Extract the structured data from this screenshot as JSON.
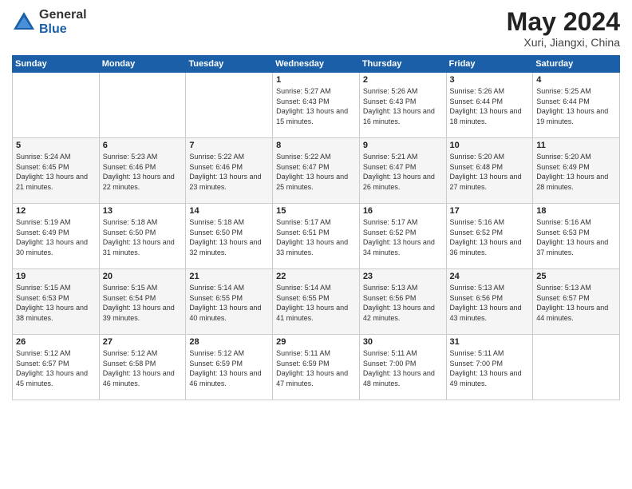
{
  "logo": {
    "general": "General",
    "blue": "Blue"
  },
  "title": "May 2024",
  "subtitle": "Xuri, Jiangxi, China",
  "weekdays": [
    "Sunday",
    "Monday",
    "Tuesday",
    "Wednesday",
    "Thursday",
    "Friday",
    "Saturday"
  ],
  "weeks": [
    [
      {
        "day": "",
        "sunrise": "",
        "sunset": "",
        "daylight": ""
      },
      {
        "day": "",
        "sunrise": "",
        "sunset": "",
        "daylight": ""
      },
      {
        "day": "",
        "sunrise": "",
        "sunset": "",
        "daylight": ""
      },
      {
        "day": "1",
        "sunrise": "Sunrise: 5:27 AM",
        "sunset": "Sunset: 6:43 PM",
        "daylight": "Daylight: 13 hours and 15 minutes."
      },
      {
        "day": "2",
        "sunrise": "Sunrise: 5:26 AM",
        "sunset": "Sunset: 6:43 PM",
        "daylight": "Daylight: 13 hours and 16 minutes."
      },
      {
        "day": "3",
        "sunrise": "Sunrise: 5:26 AM",
        "sunset": "Sunset: 6:44 PM",
        "daylight": "Daylight: 13 hours and 18 minutes."
      },
      {
        "day": "4",
        "sunrise": "Sunrise: 5:25 AM",
        "sunset": "Sunset: 6:44 PM",
        "daylight": "Daylight: 13 hours and 19 minutes."
      }
    ],
    [
      {
        "day": "5",
        "sunrise": "Sunrise: 5:24 AM",
        "sunset": "Sunset: 6:45 PM",
        "daylight": "Daylight: 13 hours and 21 minutes."
      },
      {
        "day": "6",
        "sunrise": "Sunrise: 5:23 AM",
        "sunset": "Sunset: 6:46 PM",
        "daylight": "Daylight: 13 hours and 22 minutes."
      },
      {
        "day": "7",
        "sunrise": "Sunrise: 5:22 AM",
        "sunset": "Sunset: 6:46 PM",
        "daylight": "Daylight: 13 hours and 23 minutes."
      },
      {
        "day": "8",
        "sunrise": "Sunrise: 5:22 AM",
        "sunset": "Sunset: 6:47 PM",
        "daylight": "Daylight: 13 hours and 25 minutes."
      },
      {
        "day": "9",
        "sunrise": "Sunrise: 5:21 AM",
        "sunset": "Sunset: 6:47 PM",
        "daylight": "Daylight: 13 hours and 26 minutes."
      },
      {
        "day": "10",
        "sunrise": "Sunrise: 5:20 AM",
        "sunset": "Sunset: 6:48 PM",
        "daylight": "Daylight: 13 hours and 27 minutes."
      },
      {
        "day": "11",
        "sunrise": "Sunrise: 5:20 AM",
        "sunset": "Sunset: 6:49 PM",
        "daylight": "Daylight: 13 hours and 28 minutes."
      }
    ],
    [
      {
        "day": "12",
        "sunrise": "Sunrise: 5:19 AM",
        "sunset": "Sunset: 6:49 PM",
        "daylight": "Daylight: 13 hours and 30 minutes."
      },
      {
        "day": "13",
        "sunrise": "Sunrise: 5:18 AM",
        "sunset": "Sunset: 6:50 PM",
        "daylight": "Daylight: 13 hours and 31 minutes."
      },
      {
        "day": "14",
        "sunrise": "Sunrise: 5:18 AM",
        "sunset": "Sunset: 6:50 PM",
        "daylight": "Daylight: 13 hours and 32 minutes."
      },
      {
        "day": "15",
        "sunrise": "Sunrise: 5:17 AM",
        "sunset": "Sunset: 6:51 PM",
        "daylight": "Daylight: 13 hours and 33 minutes."
      },
      {
        "day": "16",
        "sunrise": "Sunrise: 5:17 AM",
        "sunset": "Sunset: 6:52 PM",
        "daylight": "Daylight: 13 hours and 34 minutes."
      },
      {
        "day": "17",
        "sunrise": "Sunrise: 5:16 AM",
        "sunset": "Sunset: 6:52 PM",
        "daylight": "Daylight: 13 hours and 36 minutes."
      },
      {
        "day": "18",
        "sunrise": "Sunrise: 5:16 AM",
        "sunset": "Sunset: 6:53 PM",
        "daylight": "Daylight: 13 hours and 37 minutes."
      }
    ],
    [
      {
        "day": "19",
        "sunrise": "Sunrise: 5:15 AM",
        "sunset": "Sunset: 6:53 PM",
        "daylight": "Daylight: 13 hours and 38 minutes."
      },
      {
        "day": "20",
        "sunrise": "Sunrise: 5:15 AM",
        "sunset": "Sunset: 6:54 PM",
        "daylight": "Daylight: 13 hours and 39 minutes."
      },
      {
        "day": "21",
        "sunrise": "Sunrise: 5:14 AM",
        "sunset": "Sunset: 6:55 PM",
        "daylight": "Daylight: 13 hours and 40 minutes."
      },
      {
        "day": "22",
        "sunrise": "Sunrise: 5:14 AM",
        "sunset": "Sunset: 6:55 PM",
        "daylight": "Daylight: 13 hours and 41 minutes."
      },
      {
        "day": "23",
        "sunrise": "Sunrise: 5:13 AM",
        "sunset": "Sunset: 6:56 PM",
        "daylight": "Daylight: 13 hours and 42 minutes."
      },
      {
        "day": "24",
        "sunrise": "Sunrise: 5:13 AM",
        "sunset": "Sunset: 6:56 PM",
        "daylight": "Daylight: 13 hours and 43 minutes."
      },
      {
        "day": "25",
        "sunrise": "Sunrise: 5:13 AM",
        "sunset": "Sunset: 6:57 PM",
        "daylight": "Daylight: 13 hours and 44 minutes."
      }
    ],
    [
      {
        "day": "26",
        "sunrise": "Sunrise: 5:12 AM",
        "sunset": "Sunset: 6:57 PM",
        "daylight": "Daylight: 13 hours and 45 minutes."
      },
      {
        "day": "27",
        "sunrise": "Sunrise: 5:12 AM",
        "sunset": "Sunset: 6:58 PM",
        "daylight": "Daylight: 13 hours and 46 minutes."
      },
      {
        "day": "28",
        "sunrise": "Sunrise: 5:12 AM",
        "sunset": "Sunset: 6:59 PM",
        "daylight": "Daylight: 13 hours and 46 minutes."
      },
      {
        "day": "29",
        "sunrise": "Sunrise: 5:11 AM",
        "sunset": "Sunset: 6:59 PM",
        "daylight": "Daylight: 13 hours and 47 minutes."
      },
      {
        "day": "30",
        "sunrise": "Sunrise: 5:11 AM",
        "sunset": "Sunset: 7:00 PM",
        "daylight": "Daylight: 13 hours and 48 minutes."
      },
      {
        "day": "31",
        "sunrise": "Sunrise: 5:11 AM",
        "sunset": "Sunset: 7:00 PM",
        "daylight": "Daylight: 13 hours and 49 minutes."
      },
      {
        "day": "",
        "sunrise": "",
        "sunset": "",
        "daylight": ""
      }
    ]
  ]
}
